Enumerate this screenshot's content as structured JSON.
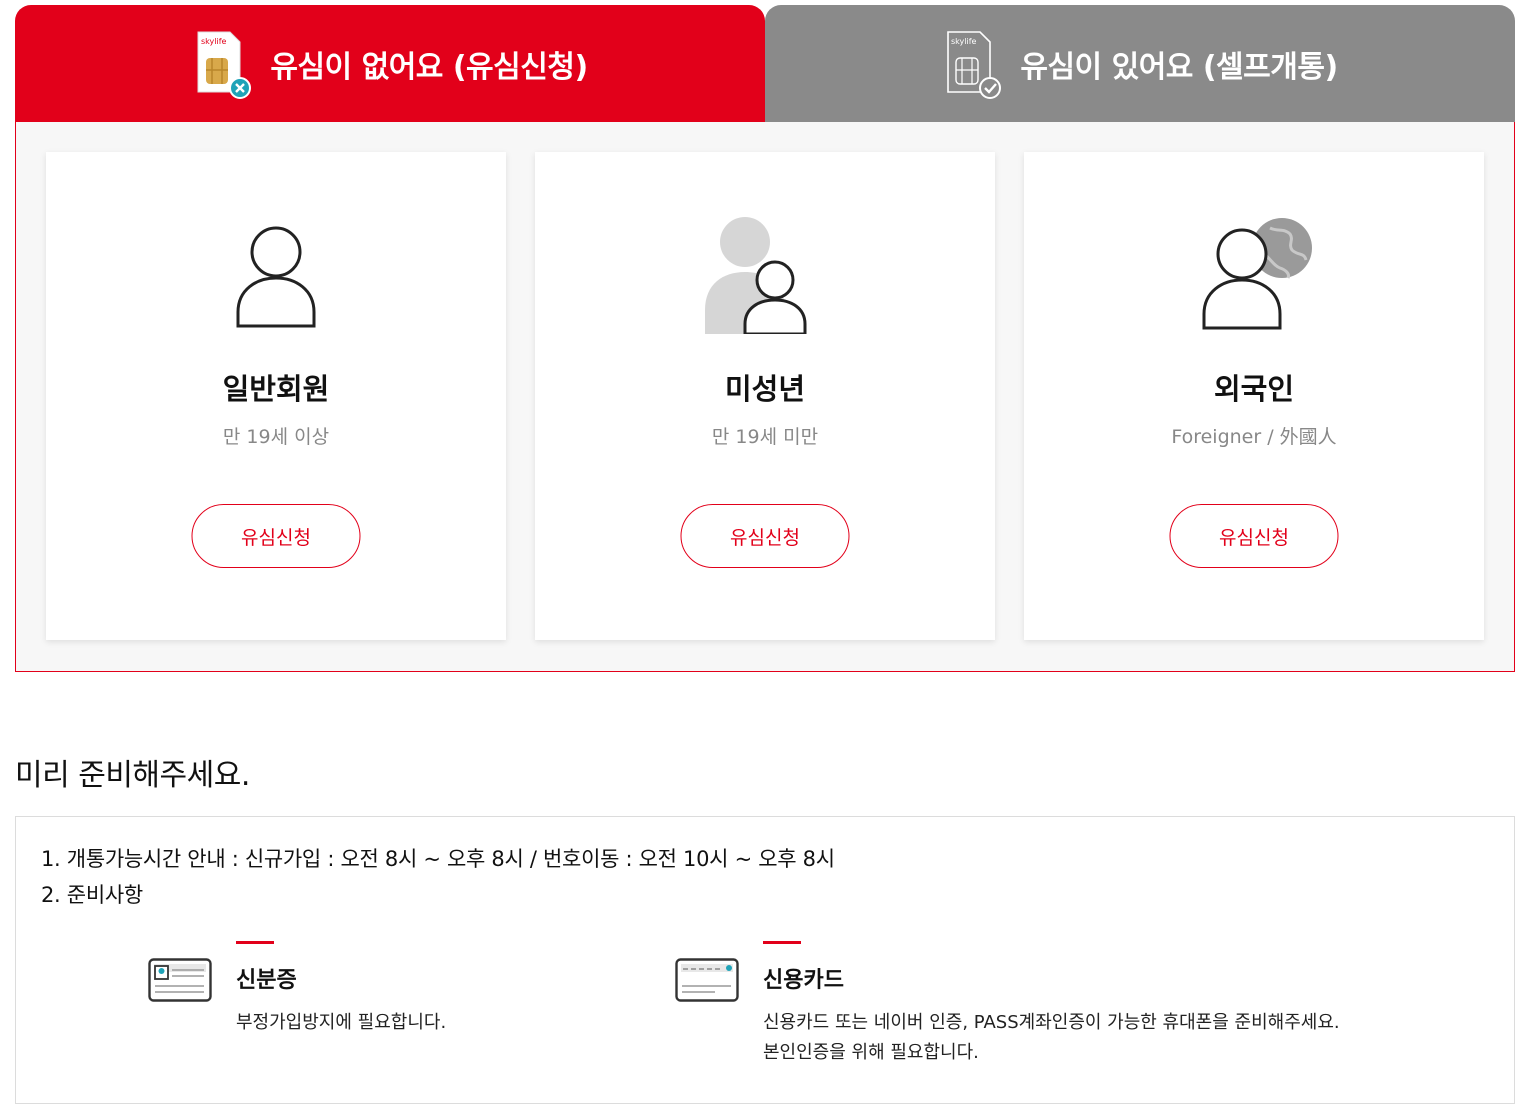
{
  "tabs": [
    {
      "label": "유심이 없어요 (유심신청)",
      "icon": "sim-card-x-icon",
      "active": true,
      "brand": "skylife"
    },
    {
      "label": "유심이 있어요 (셀프개통)",
      "icon": "sim-card-check-icon",
      "active": false,
      "brand": "skylife"
    }
  ],
  "cards": [
    {
      "title": "일반회원",
      "subtitle": "만 19세 이상",
      "button": "유심신청",
      "icon": "person-icon"
    },
    {
      "title": "미성년",
      "subtitle": "만 19세 미만",
      "button": "유심신청",
      "icon": "minor-person-icon"
    },
    {
      "title": "외국인",
      "subtitle": "Foreigner / 外國人",
      "button": "유심신청",
      "icon": "foreigner-globe-icon"
    }
  ],
  "prepare": {
    "title": "미리 준비해주세요.",
    "line1": "1. 개통가능시간 안내 : 신규가입 : 오전 8시 ~ 오후 8시 / 번호이동 : 오전 10시 ~ 오후 8시",
    "line2": "2. 준비사항",
    "items": [
      {
        "title": "신분증",
        "desc": [
          "부정가입방지에 필요합니다."
        ],
        "icon": "id-card-icon"
      },
      {
        "title": "신용카드",
        "desc": [
          "신용카드 또는 네이버 인증, PASS계좌인증이 가능한 휴대폰을 준비해주세요.",
          "본인인증을 위해 필요합니다."
        ],
        "icon": "credit-card-icon"
      }
    ]
  },
  "colors": {
    "accent": "#e2001a",
    "inactive_tab": "#8a8a8a",
    "panel_bg": "#f7f7f7"
  }
}
